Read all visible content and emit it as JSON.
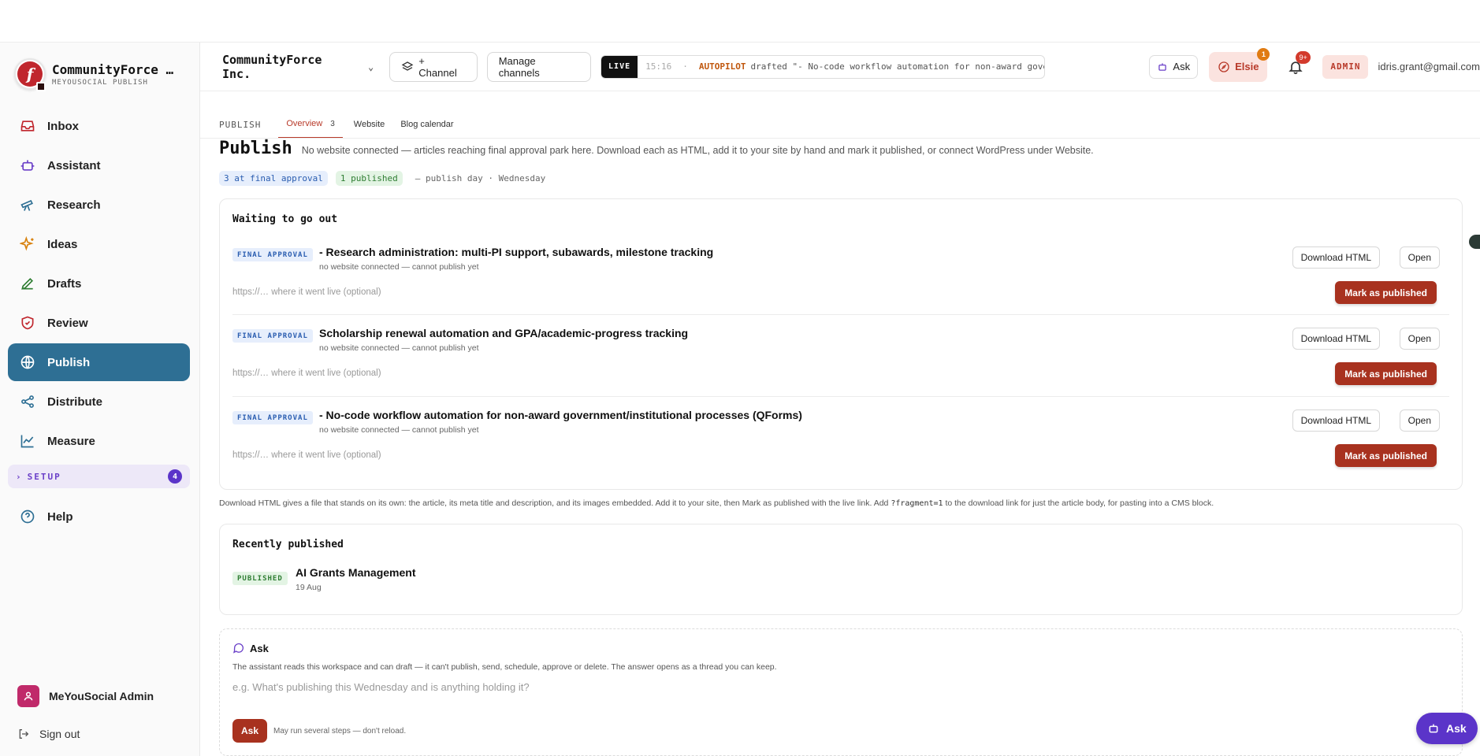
{
  "brand": {
    "name": "CommunityForce …",
    "sub": "MEYOUSOCIAL PUBLISH"
  },
  "nav": [
    {
      "label": "Inbox",
      "icon": "inbox-icon"
    },
    {
      "label": "Assistant",
      "icon": "robot-icon"
    },
    {
      "label": "Research",
      "icon": "telescope-icon"
    },
    {
      "label": "Ideas",
      "icon": "sparkles-icon"
    },
    {
      "label": "Drafts",
      "icon": "pen-icon"
    },
    {
      "label": "Review",
      "icon": "shield-check-icon"
    },
    {
      "label": "Publish",
      "icon": "globe-icon"
    },
    {
      "label": "Distribute",
      "icon": "share-icon"
    },
    {
      "label": "Measure",
      "icon": "chart-line-icon"
    }
  ],
  "setup": {
    "label": "SETUP",
    "count": "4"
  },
  "help": {
    "label": "Help"
  },
  "user": {
    "name": "MeYouSocial Admin"
  },
  "signout": {
    "label": "Sign out"
  },
  "header": {
    "org": "CommunityForce Inc.",
    "channel_btn": "+ Channel",
    "manage_btn": "Manage channels",
    "live_tag": "LIVE",
    "live_time": "15:16",
    "live_dash": "·",
    "live_actor": "AUTOPILOT",
    "live_msg": "drafted \"- No-code workflow automation for non-award gover",
    "ask": "Ask",
    "elsie": "Elsie",
    "elsie_badge": "1",
    "bell_badge": "9+",
    "admin": "ADMIN",
    "email": "idris.grant@gmail.com"
  },
  "tabs": {
    "section": "PUBLISH",
    "overview": "Overview",
    "overview_count": "3",
    "website": "Website",
    "blog": "Blog calendar"
  },
  "page": {
    "title": "Publish",
    "desc": "No website connected — articles reaching final approval park here. Download each as HTML, add it to your site by hand and mark it published, or connect WordPress under Website.",
    "chip_final": "3 at final approval",
    "chip_pub": "1 published",
    "publish_day": "— publish day · Wednesday"
  },
  "waiting": {
    "title": "Waiting to go out",
    "badge": "FINAL APPROVAL",
    "sub": "no website connected — cannot publish yet",
    "placeholder": "https://… where it went live (optional)",
    "download": "Download HTML",
    "open": "Open",
    "mark": "Mark as published",
    "items": [
      {
        "title": "- Research administration: multi-PI support, subawards, milestone tracking"
      },
      {
        "title": "Scholarship renewal automation and GPA/academic-progress tracking"
      },
      {
        "title": "- No-code workflow automation for non-award government/institutional processes (QForms)"
      }
    ]
  },
  "note": {
    "a": "Download HTML gives a file that stands on its own: the article, its meta title and description, and its images embedded. Add it to your site, then Mark as published with the live link. Add ",
    "code": "?fragment=1",
    "b": " to the download link for just the article body, for pasting into a CMS block."
  },
  "recent": {
    "title": "Recently published",
    "badge": "PUBLISHED",
    "item_title": "AI Grants Management",
    "item_date": "19 Aug"
  },
  "ask_panel": {
    "title": "Ask",
    "desc": "The assistant reads this workspace and can draft — it can't publish, send, schedule, approve or delete. The answer opens as a thread you can keep.",
    "placeholder": "e.g. What's publishing this Wednesday and is anything holding it?",
    "submit": "Ask",
    "hint": "May run several steps — don't reload."
  },
  "fab": {
    "label": "Ask"
  },
  "colors": {
    "accent": "#a8321f",
    "nav_active": "#2e6f94",
    "purple": "#5b34c9"
  }
}
